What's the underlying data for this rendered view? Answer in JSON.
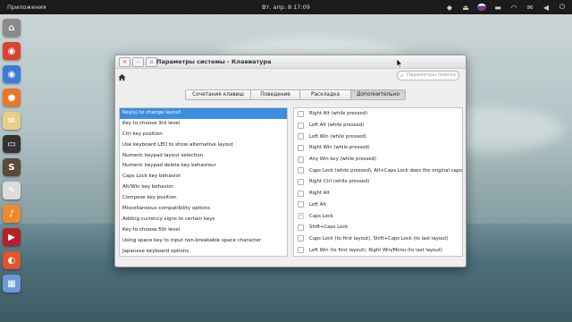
{
  "panel": {
    "apps_label": "Приложения",
    "clock": "Вт. апр. 8 17:09"
  },
  "window": {
    "title": "Параметры системы - Клавиатура",
    "search_placeholder": "Параметры поиска",
    "tabs": [
      "Сочетания клавиш",
      "Поведение",
      "Раскладка",
      "Дополнительно"
    ],
    "active_tab": 3,
    "options": [
      "Key(s) to change layout",
      "Key to choose 3rd level",
      "Ctrl key position",
      "Use keyboard LED to show alternative layout",
      "Numeric keypad layout selection",
      "Numeric keypad delete key behaviour",
      "Caps Lock key behavior",
      "Alt/Win key behavior",
      "Compose key position",
      "Miscellaneous compatibility options",
      "Adding currency signs to certain keys",
      "Key to choose 5th level",
      "Using space key to input non-breakable space character",
      "Japanese keyboard options"
    ],
    "selected_option": 0,
    "choices": [
      {
        "label": "Right Alt (while pressed)",
        "checked": false
      },
      {
        "label": "Left Alt (while pressed)",
        "checked": false
      },
      {
        "label": "Left Win (while pressed)",
        "checked": false
      },
      {
        "label": "Right Win (while pressed)",
        "checked": false
      },
      {
        "label": "Any Win key (while pressed)",
        "checked": false
      },
      {
        "label": "Caps Lock (while pressed), Alt+Caps Lock does the original capslo",
        "checked": false
      },
      {
        "label": "Right Ctrl (while pressed)",
        "checked": false
      },
      {
        "label": "Right Alt",
        "checked": false
      },
      {
        "label": "Left Alt",
        "checked": false
      },
      {
        "label": "Caps Lock",
        "checked": true
      },
      {
        "label": "Shift+Caps Lock",
        "checked": false
      },
      {
        "label": "Caps Lock (to first layout), Shift+Caps Lock (to last layout)",
        "checked": false
      },
      {
        "label": "Left Win (to first layout), Right Win/Menu (to last layout)",
        "checked": false
      }
    ]
  },
  "dock": [
    {
      "name": "home-folder-icon",
      "color": "#8a8a8a",
      "glyph": "⌂"
    },
    {
      "name": "chrome-icon",
      "color": "#d8452f",
      "glyph": "◉"
    },
    {
      "name": "chromium-icon",
      "color": "#3b7cd6",
      "glyph": "◉"
    },
    {
      "name": "firefox-icon",
      "color": "#e8772a",
      "glyph": "●"
    },
    {
      "name": "mail-icon",
      "color": "#e7cf8a",
      "glyph": "✉"
    },
    {
      "name": "terminal-icon",
      "color": "#333333",
      "glyph": "▭"
    },
    {
      "name": "sublime-text-icon",
      "color": "#5a4a3a",
      "glyph": "S"
    },
    {
      "name": "text-editor-icon",
      "color": "#dcdcdc",
      "glyph": "✎"
    },
    {
      "name": "music-icon",
      "color": "#f08a2a",
      "glyph": "♪"
    },
    {
      "name": "video-player-icon",
      "color": "#b5202a",
      "glyph": "▶"
    },
    {
      "name": "photo-shotwell-icon",
      "color": "#e0552c",
      "glyph": "◐"
    },
    {
      "name": "system-settings-icon",
      "color": "#6a9bd6",
      "glyph": "▦"
    }
  ]
}
